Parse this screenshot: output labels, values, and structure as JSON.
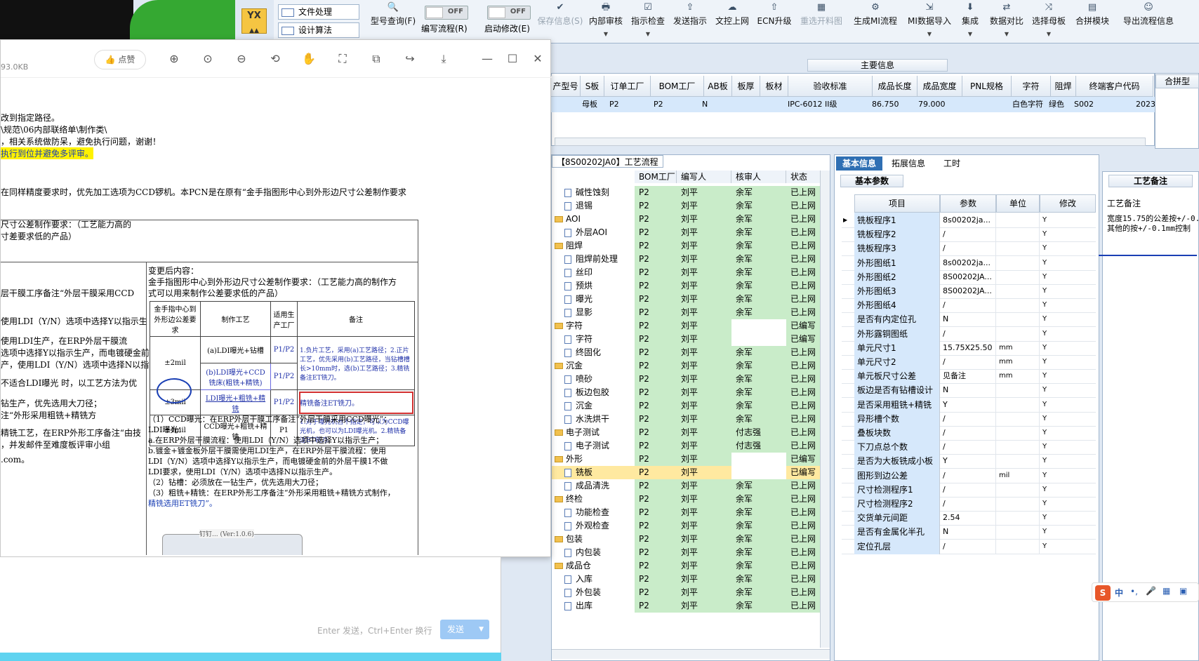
{
  "toolbar": {
    "side_items": [
      "文件处理",
      "设计算法"
    ],
    "toggles": [
      {
        "text": "OFF",
        "label": "编写流程(R)"
      },
      {
        "text": "OFF",
        "label": "启动修改(E)"
      }
    ],
    "buttons": [
      "型号查询(F)",
      "保存信息(S)",
      "内部审核",
      "指示检查",
      "发送指示",
      "文控上网",
      "ECN升级",
      "重选开料图",
      "生成MI流程",
      "MI数据导入",
      "集成",
      "数据对比",
      "选择母板",
      "合拼模块",
      "导出流程信息"
    ]
  },
  "viewer": {
    "file_size": "93.0KB",
    "like_label": "点赞",
    "input_hint": "Enter 发送，Ctrl+Enter 换行",
    "send_label": "发送",
    "thumb_caption": "钉钉... (Ver:1.0.6)",
    "doc_lines": [
      "改到指定路径。",
      "\\规范\\06内部联络单\\制作类\\",
      "，相关系统做防呆，避免执行问题，谢谢！",
      "执行到位并避免多评审。",
      "在同样精度要求时，优先加工选项为CCD锣机。本PCN是在原有“金手指图形中心到外形边尺寸公差制作要求",
      "尺寸公差制作要求：（工艺能力高的",
      "寸差要求低的产品）",
      "层干膜工序备注“外层干膜采用CCD",
      "使用LDI（Y/N）选项中选择Y以指示生",
      "使用LDI生产，在ERP外层干膜流",
      "选项中选择Y以指示生产，而电镀硬金前",
      "产，使用LDI（Y/N）选项中选择N以指",
      "不适合LDI曝光 时，以工艺方法为优",
      "钻生产，优先选用大刀径；",
      "注“外形采用粗铣+精铣方",
      "精铣工艺，在ERP外形工序备注“由技",
      "，并发邮件至难度板评审小组",
      ".com。"
    ],
    "change_title": "变更后内容：",
    "change_line1": "金手指图形中心到外形边尺寸公差制作要求：（工艺能力高的制作方",
    "change_line2": "式可以用来制作公差要求低的产品）",
    "table": {
      "headers": [
        "金手指中心到外形边公差要求",
        "制作工艺",
        "适用生产工厂",
        "备注"
      ],
      "rows": [
        [
          "±2mil",
          "(a)LDI曝光+钻槽",
          "P1/P2",
          "1.负片工艺，采用(a)工艺路径；2.正片工艺，优先采用(b)工艺路径，当钻槽槽长>10mm时，选(b)工艺路径；3.精铣备注ET铣刀。"
        ],
        [
          "",
          "(b)LDI曝光+CCD铣床(粗铣+精铣)",
          "P1/P2",
          ""
        ],
        [
          "±3mil",
          "LDI曝光+粗铣+精铣",
          "P1/P2",
          "精铣备注ET铣刀。"
        ],
        [
          "±4mil",
          "CCD曝光+粗铣+精铣",
          "P1",
          "1.对于曝光机台不指定，可以为CCD曝光机，也可以为LDI曝光机。2.精铣备注ET铣刀。"
        ]
      ]
    },
    "notes": [
      "（1）CCD曝光：在ERP外层干膜工序备注“外层干膜采用CCD曝光”；",
      "LDI曝光：",
      "a.在ERP外层干膜流程：使用LDI（Y/N）选项中选择Y以指示生产；",
      "b.镀金+镀金板外层干膜需使用LDI生产，在ERP外层干膜流程：使用",
      "LDI（Y/N）选项中选择Y以指示生产，而电镀硬金前的外层干膜1不做",
      "LDI要求，使用LDI（Y/N）选项中选择N以指示生产。",
      "（2）钻槽：必须放在一钻生产，优先选用大刀径；",
      "（3）粗铣+精铣：在ERP外形工序备注“外形采用粗铣+精铣方式制作，",
      "精铣选用ET铣刀”。"
    ]
  },
  "main_info": {
    "section_title": "主要信息",
    "columns": [
      "产型号",
      "S板",
      "订单工厂",
      "BOM工厂",
      "AB板",
      "板厚",
      "板材",
      "验收标准",
      "成品长度",
      "成品宽度",
      "PNL规格",
      "字符",
      "阻焊",
      "终端客户代码"
    ],
    "row": [
      "母板",
      "P2",
      "P2",
      "N",
      "",
      "",
      "IPC-6012 II级",
      "86.750",
      "79.000",
      "",
      "白色字符",
      "绿色",
      "S002",
      "2023"
    ],
    "right_label": "合拼型"
  },
  "process": {
    "title": "【8S00202JA0】工艺流程",
    "columns": [
      "BOM工厂",
      "编写人",
      "核审人",
      "状态"
    ],
    "rows": [
      {
        "name": "碱性蚀刻",
        "type": "file",
        "bom": "P2",
        "author": "刘平",
        "reviewer": "余军",
        "status": "已上网"
      },
      {
        "name": "退锡",
        "type": "file",
        "bom": "P2",
        "author": "刘平",
        "reviewer": "余军",
        "status": "已上网"
      },
      {
        "name": "AOI",
        "type": "folder",
        "bom": "P2",
        "author": "刘平",
        "reviewer": "余军",
        "status": "已上网"
      },
      {
        "name": "外层AOI",
        "type": "file",
        "bom": "P2",
        "author": "刘平",
        "reviewer": "余军",
        "status": "已上网"
      },
      {
        "name": "阻焊",
        "type": "folder",
        "bom": "P2",
        "author": "刘平",
        "reviewer": "余军",
        "status": "已上网"
      },
      {
        "name": "阻焊前处理",
        "type": "file",
        "bom": "P2",
        "author": "刘平",
        "reviewer": "余军",
        "status": "已上网"
      },
      {
        "name": "丝印",
        "type": "file",
        "bom": "P2",
        "author": "刘平",
        "reviewer": "余军",
        "status": "已上网"
      },
      {
        "name": "预烘",
        "type": "file",
        "bom": "P2",
        "author": "刘平",
        "reviewer": "余军",
        "status": "已上网"
      },
      {
        "name": "曝光",
        "type": "file",
        "bom": "P2",
        "author": "刘平",
        "reviewer": "余军",
        "status": "已上网"
      },
      {
        "name": "显影",
        "type": "file",
        "bom": "P2",
        "author": "刘平",
        "reviewer": "余军",
        "status": "已上网"
      },
      {
        "name": "字符",
        "type": "folder",
        "bom": "P2",
        "author": "刘平",
        "reviewer": "",
        "status": "已编写"
      },
      {
        "name": "字符",
        "type": "file",
        "bom": "P2",
        "author": "刘平",
        "reviewer": "",
        "status": "已编写"
      },
      {
        "name": "终固化",
        "type": "file",
        "bom": "P2",
        "author": "刘平",
        "reviewer": "余军",
        "status": "已上网"
      },
      {
        "name": "沉金",
        "type": "folder",
        "bom": "P2",
        "author": "刘平",
        "reviewer": "余军",
        "status": "已上网"
      },
      {
        "name": "喷砂",
        "type": "file",
        "bom": "P2",
        "author": "刘平",
        "reviewer": "余军",
        "status": "已上网"
      },
      {
        "name": "板边包胶",
        "type": "file",
        "bom": "P2",
        "author": "刘平",
        "reviewer": "余军",
        "status": "已上网"
      },
      {
        "name": "沉金",
        "type": "file",
        "bom": "P2",
        "author": "刘平",
        "reviewer": "余军",
        "status": "已上网"
      },
      {
        "name": "水洗烘干",
        "type": "file",
        "bom": "P2",
        "author": "刘平",
        "reviewer": "余军",
        "status": "已上网"
      },
      {
        "name": "电子测试",
        "type": "folder",
        "bom": "P2",
        "author": "刘平",
        "reviewer": "付志强",
        "status": "已上网"
      },
      {
        "name": "电子测试",
        "type": "file",
        "bom": "P2",
        "author": "刘平",
        "reviewer": "付志强",
        "status": "已上网"
      },
      {
        "name": "外形",
        "type": "folder",
        "bom": "P2",
        "author": "刘平",
        "reviewer": "",
        "status": "已编写"
      },
      {
        "name": "铣板",
        "type": "file",
        "bom": "P2",
        "author": "刘平",
        "reviewer": "",
        "status": "已编写",
        "selected": true
      },
      {
        "name": "成品清洗",
        "type": "file",
        "bom": "P2",
        "author": "刘平",
        "reviewer": "余军",
        "status": "已上网"
      },
      {
        "name": "终检",
        "type": "folder",
        "bom": "P2",
        "author": "刘平",
        "reviewer": "余军",
        "status": "已上网"
      },
      {
        "name": "功能检查",
        "type": "file",
        "bom": "P2",
        "author": "刘平",
        "reviewer": "余军",
        "status": "已上网"
      },
      {
        "name": "外观检查",
        "type": "file",
        "bom": "P2",
        "author": "刘平",
        "reviewer": "余军",
        "status": "已上网"
      },
      {
        "name": "包装",
        "type": "folder",
        "bom": "P2",
        "author": "刘平",
        "reviewer": "余军",
        "status": "已上网"
      },
      {
        "name": "内包装",
        "type": "file",
        "bom": "P2",
        "author": "刘平",
        "reviewer": "余军",
        "status": "已上网"
      },
      {
        "name": "成品仓",
        "type": "folder",
        "bom": "P2",
        "author": "刘平",
        "reviewer": "余军",
        "status": "已上网"
      },
      {
        "name": "入库",
        "type": "file",
        "bom": "P2",
        "author": "刘平",
        "reviewer": "余军",
        "status": "已上网"
      },
      {
        "name": "外包装",
        "type": "file",
        "bom": "P2",
        "author": "刘平",
        "reviewer": "余军",
        "status": "已上网"
      },
      {
        "name": "出库",
        "type": "file",
        "bom": "P2",
        "author": "刘平",
        "reviewer": "余军",
        "status": "已上网"
      }
    ]
  },
  "params": {
    "tabs": [
      "基本信息",
      "拓展信息",
      "工时"
    ],
    "section": "基本参数",
    "columns": [
      "项目",
      "参数",
      "单位",
      "修改"
    ],
    "rows": [
      {
        "k": "铣板程序1",
        "v": "8s00202ja...",
        "u": "",
        "m": "Y"
      },
      {
        "k": "铣板程序2",
        "v": "/",
        "u": "",
        "m": "Y"
      },
      {
        "k": "铣板程序3",
        "v": "/",
        "u": "",
        "m": "Y"
      },
      {
        "k": "外形图纸1",
        "v": "8s00202ja...",
        "u": "",
        "m": "Y"
      },
      {
        "k": "外形图纸2",
        "v": "8S00202JA...",
        "u": "",
        "m": "Y"
      },
      {
        "k": "外形图纸3",
        "v": "8S00202JA...",
        "u": "",
        "m": "Y"
      },
      {
        "k": "外形图纸4",
        "v": "/",
        "u": "",
        "m": "Y"
      },
      {
        "k": "是否有内定位孔",
        "v": "N",
        "u": "",
        "m": "Y"
      },
      {
        "k": "外形露铜图纸",
        "v": "/",
        "u": "",
        "m": "Y"
      },
      {
        "k": "单元尺寸1",
        "v": "15.75X25.50",
        "u": "mm",
        "m": "Y"
      },
      {
        "k": "单元尺寸2",
        "v": "/",
        "u": "mm",
        "m": "Y"
      },
      {
        "k": "单元板尺寸公差",
        "v": "见备注",
        "u": "mm",
        "m": "Y"
      },
      {
        "k": "板边是否有钻槽设计",
        "v": "N",
        "u": "",
        "m": "Y"
      },
      {
        "k": "是否采用粗铣+精铣",
        "v": "Y",
        "u": "",
        "m": "Y"
      },
      {
        "k": "异形槽个数",
        "v": "/",
        "u": "",
        "m": "Y"
      },
      {
        "k": "叠板块数",
        "v": "/",
        "u": "",
        "m": "Y"
      },
      {
        "k": "下刀点总个数",
        "v": "/",
        "u": "",
        "m": "Y"
      },
      {
        "k": "是否为大板铣成小板",
        "v": "Y",
        "u": "",
        "m": "Y"
      },
      {
        "k": "图形到边公差",
        "v": "/",
        "u": "mil",
        "m": "Y"
      },
      {
        "k": "尺寸检测程序1",
        "v": "/",
        "u": "",
        "m": "Y"
      },
      {
        "k": "尺寸检测程序2",
        "v": "/",
        "u": "",
        "m": "Y"
      },
      {
        "k": "交货单元间距",
        "v": "2.54",
        "u": "",
        "m": "Y"
      },
      {
        "k": "是否有金属化半孔",
        "v": "N",
        "u": "",
        "m": "Y"
      },
      {
        "k": "定位孔层",
        "v": "/",
        "u": "",
        "m": "Y"
      }
    ]
  },
  "remark": {
    "tab": "工艺备注",
    "label": "工艺备注",
    "text1": "宽度15.75的公差按+/-0.",
    "text2": "其他的按+/-0.1mm控制"
  },
  "ime": {
    "logo": "S",
    "lang": "中"
  }
}
